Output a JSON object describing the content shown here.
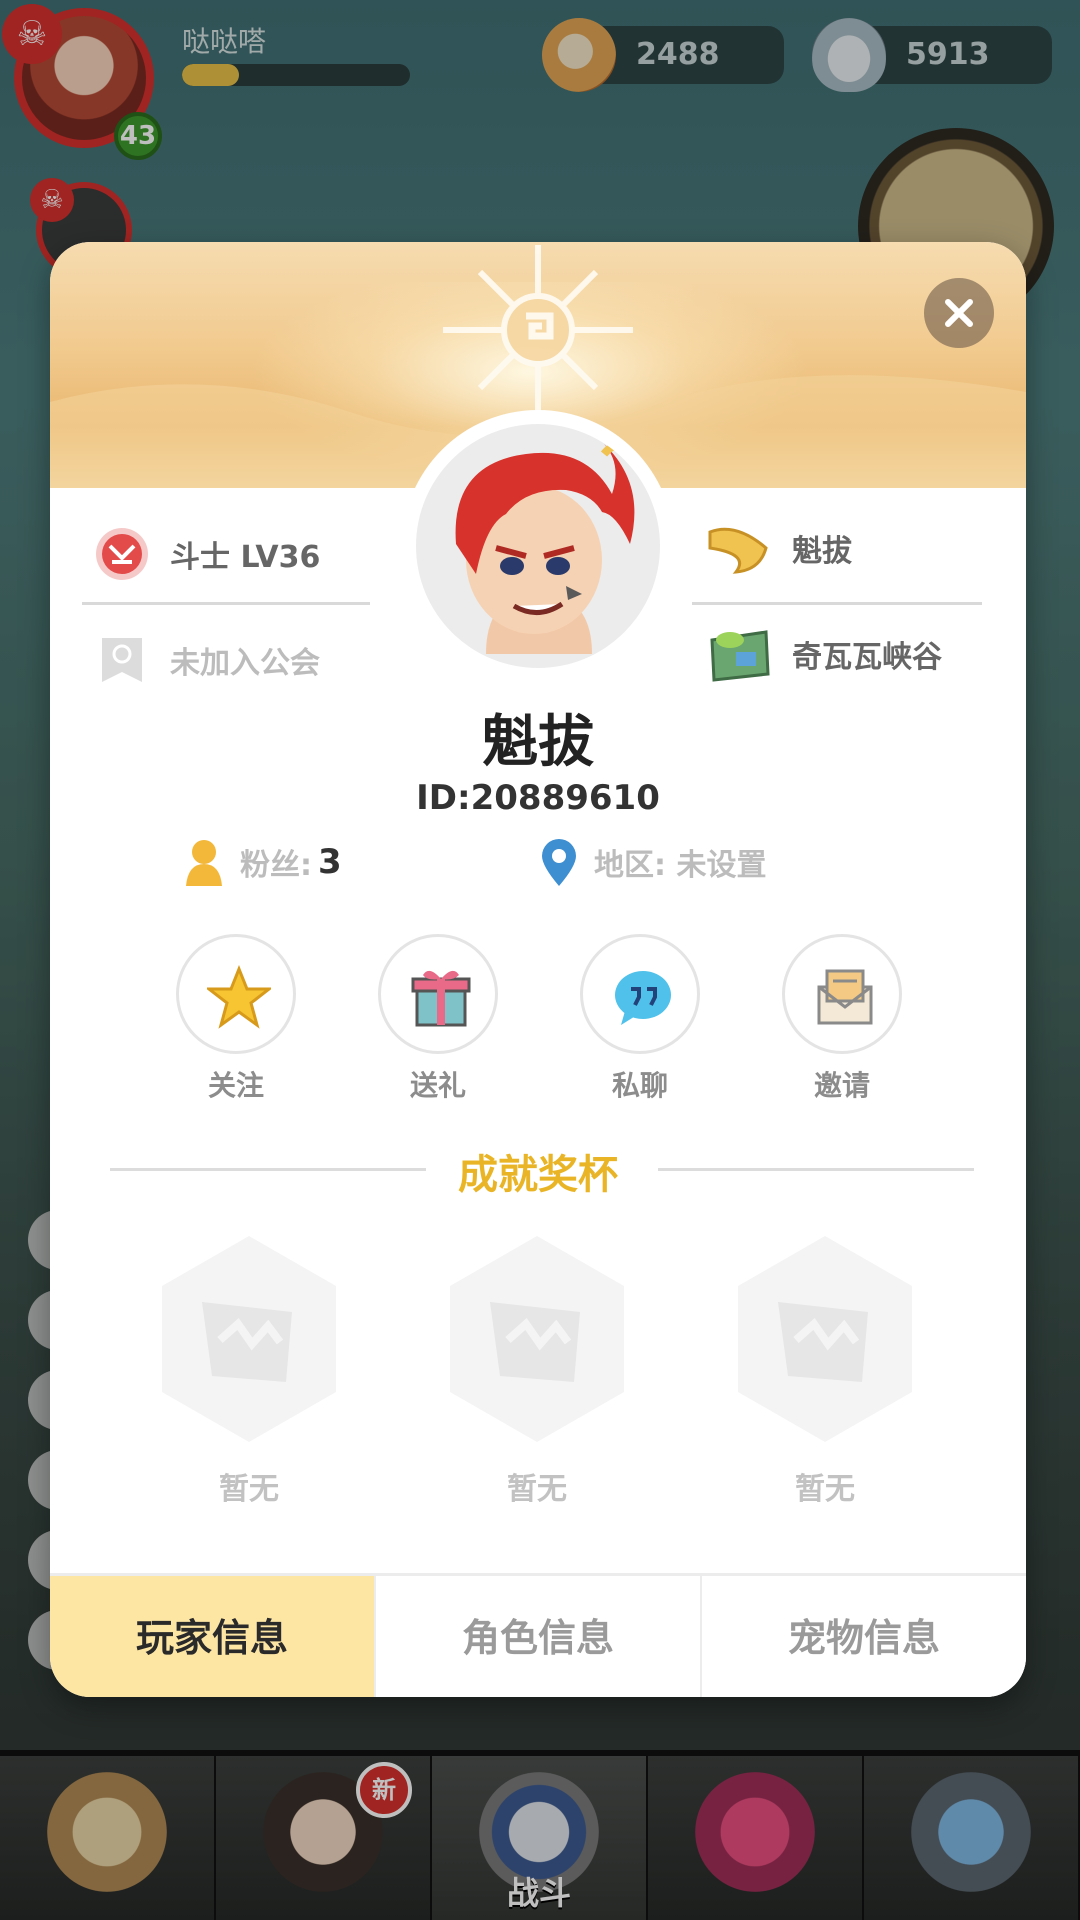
{
  "hud": {
    "player_name": "哒哒嗒",
    "level": "43",
    "xp_progress": 0.25,
    "coins": "2488",
    "shells": "5913"
  },
  "bottom_nav": {
    "battle_label": "战斗",
    "new_badge": "新"
  },
  "profile": {
    "class_level": "斗士  LV36",
    "guild": "未加入公会",
    "title": "魁拔",
    "map": "奇瓦瓦峡谷",
    "name": "魁拔",
    "id": "ID:20889610",
    "fans_label": "粉丝:",
    "fans_value": "3",
    "region": "地区: 未设置"
  },
  "actions": {
    "follow": "关注",
    "gift": "送礼",
    "chat": "私聊",
    "invite": "邀请"
  },
  "achievements": {
    "title": "成就奖杯",
    "slots": [
      "暂无",
      "暂无",
      "暂无"
    ]
  },
  "tabs": {
    "player_info": "玩家信息",
    "role_info": "角色信息",
    "pet_info": "宠物信息",
    "active": "player_info"
  },
  "colors": {
    "accent_gold": "#e9b526",
    "active_tab": "#fde6a4",
    "danger_red": "#d6302d"
  }
}
